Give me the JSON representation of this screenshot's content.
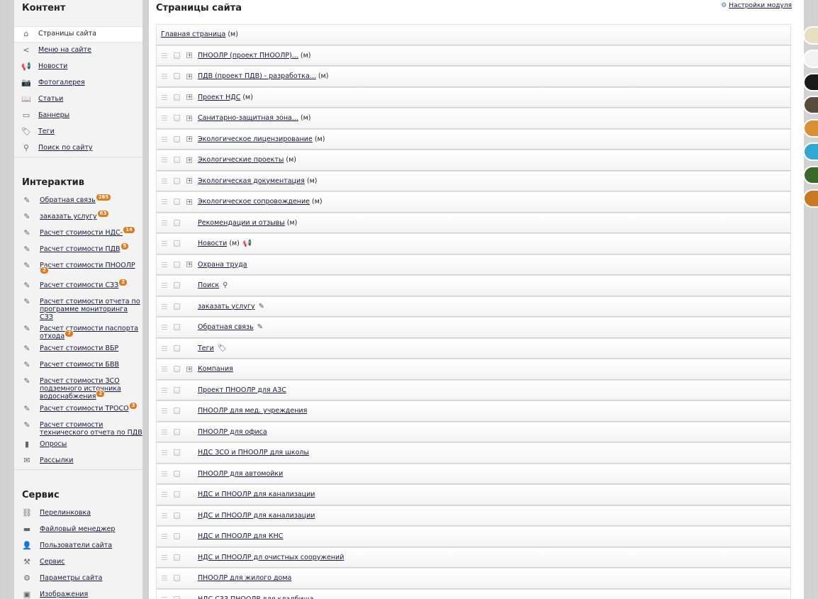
{
  "sidebar": {
    "content_title": "Контент",
    "content_items": [
      {
        "label": "Страницы сайта",
        "icon": "home-icon",
        "active": true
      },
      {
        "label": "Меню на сайте",
        "icon": "share-icon"
      },
      {
        "label": "Новости",
        "icon": "megaphone-icon"
      },
      {
        "label": "Фотогалерея",
        "icon": "camera-icon"
      },
      {
        "label": "Статьи",
        "icon": "book-icon"
      },
      {
        "label": "Баннеры",
        "icon": "banner-icon"
      },
      {
        "label": "Теги",
        "icon": "tag-icon"
      },
      {
        "label": "Поиск по сайту",
        "icon": "magnifier-icon"
      }
    ],
    "interactive_title": "Интерактив",
    "interactive_items": [
      {
        "label": "Обратная связь",
        "badge": "285"
      },
      {
        "label": "заказать услугу",
        "badge": "63"
      },
      {
        "label": "Расчет стоимости НДС-",
        "badge": "14"
      },
      {
        "label": "Расчет стоимости ПДВ",
        "badge": "5"
      },
      {
        "label": "Расчет стоимости ПНООЛР",
        "badge": "2"
      },
      {
        "label": "Расчет стоимости СЗЗ",
        "badge": "2"
      },
      {
        "label": "Расчет стоимости отчета по программе мониторинга СЗЗ",
        "badge": ""
      },
      {
        "label": "Расчет стоимости паспорта отхода",
        "badge": "7"
      },
      {
        "label": "Расчет стоимости ВБР",
        "badge": ""
      },
      {
        "label": "Расчет стоимости БВВ",
        "badge": ""
      },
      {
        "label": "Расчет стоимости ЗСО подземного источника водоснабжения",
        "badge": "2"
      },
      {
        "label": "Расчет стоимости ТРОСО",
        "badge": "3"
      },
      {
        "label": "Расчет стоимости технического отчета по ПДВ",
        "badge": ""
      },
      {
        "label": "Опросы",
        "badge": "",
        "icon": "chart-icon"
      },
      {
        "label": "Рассылки",
        "badge": "",
        "icon": "envelope-icon"
      }
    ],
    "service_title": "Сервис",
    "service_items": [
      {
        "label": "Перелинковка",
        "icon": "link-icon"
      },
      {
        "label": "Файловый менеджер",
        "icon": "folder-icon"
      },
      {
        "label": "Пользователи сайта",
        "icon": "users-icon"
      },
      {
        "label": "Сервис",
        "icon": "tools-icon"
      },
      {
        "label": "Параметры сайта",
        "icon": "settings-icon"
      },
      {
        "label": "Изображения",
        "icon": "images-icon"
      }
    ]
  },
  "main": {
    "title": "Страницы сайта",
    "settings_label": "Настройки модуля",
    "root": {
      "title": "Главная страница",
      "suffix": "(м)"
    },
    "rows": [
      {
        "title": "ПНООЛР (проект ПНООЛР)...",
        "suffix": "(м)",
        "expand": true
      },
      {
        "title": "ПДВ (проект ПДВ) - разработка...",
        "suffix": "(м)",
        "expand": true
      },
      {
        "title": "Проект НДС",
        "suffix": "(м)",
        "expand": true
      },
      {
        "title": "Санитарно-защитная зона...",
        "suffix": "(м)",
        "expand": true
      },
      {
        "title": "Экологическое лицензирование",
        "suffix": "(м)",
        "expand": true
      },
      {
        "title": "Экологические проекты",
        "suffix": "(м)",
        "expand": true
      },
      {
        "title": "Экологическая документация",
        "suffix": "(м)",
        "expand": true
      },
      {
        "title": "Экологическое сопровождение",
        "suffix": "(м)",
        "expand": true
      },
      {
        "title": "Рекомендации и отзывы",
        "suffix": "(м)",
        "expand": false
      },
      {
        "title": "Новости",
        "suffix": "(м)",
        "expand": false,
        "icon": "megaphone-icon"
      },
      {
        "title": "Охрана труда",
        "suffix": "",
        "expand": true
      },
      {
        "title": "Поиск",
        "suffix": "",
        "expand": false,
        "icon": "magnifier-icon"
      },
      {
        "title": "заказать услугу",
        "suffix": "",
        "expand": false,
        "icon": "form-icon"
      },
      {
        "title": "Обратная связь",
        "suffix": "",
        "expand": false,
        "icon": "form-icon"
      },
      {
        "title": "Теги",
        "suffix": "",
        "expand": false,
        "icon": "tag-icon"
      },
      {
        "title": "Компания",
        "suffix": "",
        "expand": true
      },
      {
        "title": "Проект ПНООЛР для АЗС",
        "suffix": "",
        "expand": false
      },
      {
        "title": "ПНООЛР для мед. учреждения",
        "suffix": "",
        "expand": false
      },
      {
        "title": "ПНООЛР для офиса",
        "suffix": "",
        "expand": false
      },
      {
        "title": "НДС ЗСО и ПНООЛР для школы",
        "suffix": "",
        "expand": false
      },
      {
        "title": "ПНООЛР для автомойки",
        "suffix": "",
        "expand": false
      },
      {
        "title": "НДС и ПНООЛР для канализации",
        "suffix": "",
        "expand": false
      },
      {
        "title": "НДС и ПНООЛР для канализации",
        "suffix": "",
        "expand": false
      },
      {
        "title": "НДС и ПНООЛР для КНС",
        "suffix": "",
        "expand": false
      },
      {
        "title": "НДС и ПНООЛР дл очистных сооружений",
        "suffix": "",
        "expand": false
      },
      {
        "title": "ПНООЛР для жилого дома",
        "suffix": "",
        "expand": false
      },
      {
        "title": "НДС СЗЗ ПНООЛР для кладбища",
        "suffix": "",
        "expand": false
      }
    ]
  },
  "thumb_colors": [
    "#e8e0c0",
    "#f2f2f2",
    "#1a1a1a",
    "#5a4a3a",
    "#d89030",
    "#30a8d0",
    "#3a6a2a",
    "#c87820"
  ]
}
